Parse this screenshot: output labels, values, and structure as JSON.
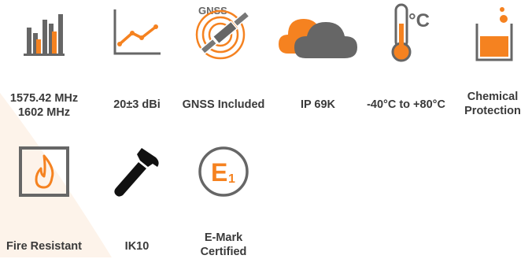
{
  "colors": {
    "accent": "#F58220",
    "gray": "#666666",
    "text": "#3a3a3a",
    "bg_shape": "#FDF3EA"
  },
  "features": [
    {
      "icon": "bar-chart-icon",
      "label": "1575.42 MHz\n1602 MHz"
    },
    {
      "icon": "line-chart-icon",
      "label": "20±3 dBi"
    },
    {
      "icon": "gnss-satellite-icon",
      "label": "GNSS Included",
      "icon_text": "GNSS"
    },
    {
      "icon": "cloud-icon",
      "label": "IP 69K"
    },
    {
      "icon": "thermometer-icon",
      "label": "-40°C to +80°C",
      "icon_text": "°C"
    },
    {
      "icon": "chemical-beaker-icon",
      "label": "Chemical\nProtection"
    },
    {
      "icon": "flame-icon",
      "label": "Fire Resistant"
    },
    {
      "icon": "hammer-icon",
      "label": "IK10"
    },
    {
      "icon": "e-mark-icon",
      "label": "E-Mark\nCertified",
      "icon_text": "E",
      "icon_subtext": "1"
    }
  ]
}
